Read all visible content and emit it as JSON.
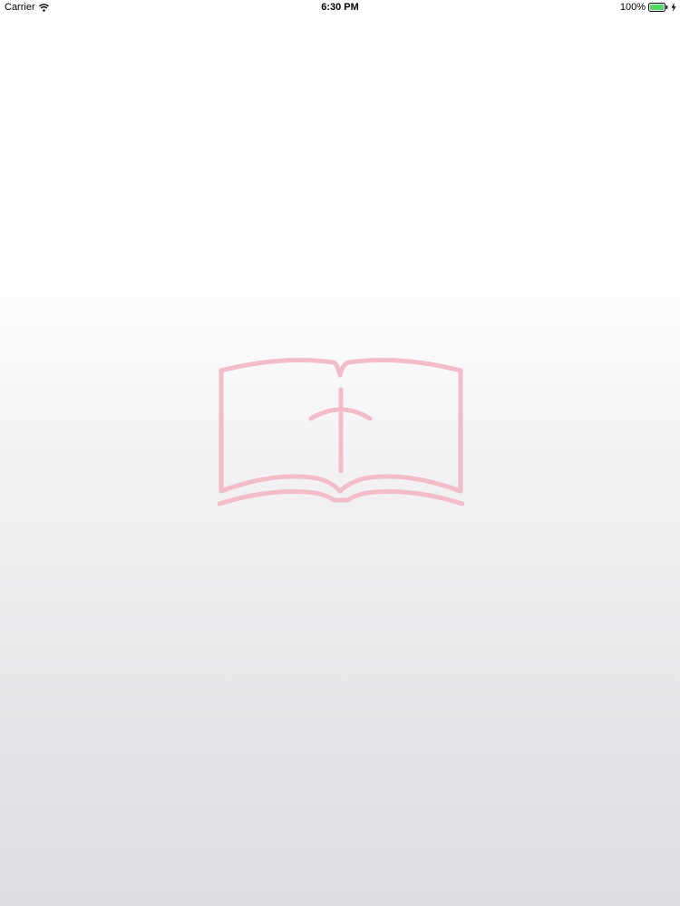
{
  "status_bar": {
    "carrier": "Carrier",
    "time": "6:30 PM",
    "battery_percent": "100%",
    "battery_level": 1.0,
    "icons": [
      "wifi-icon",
      "battery-icon",
      "charging-icon"
    ],
    "battery_color": "#4cd964"
  },
  "splash": {
    "logo_icon": "open-bible-cross-icon",
    "logo_color": "#f2bcc9"
  }
}
